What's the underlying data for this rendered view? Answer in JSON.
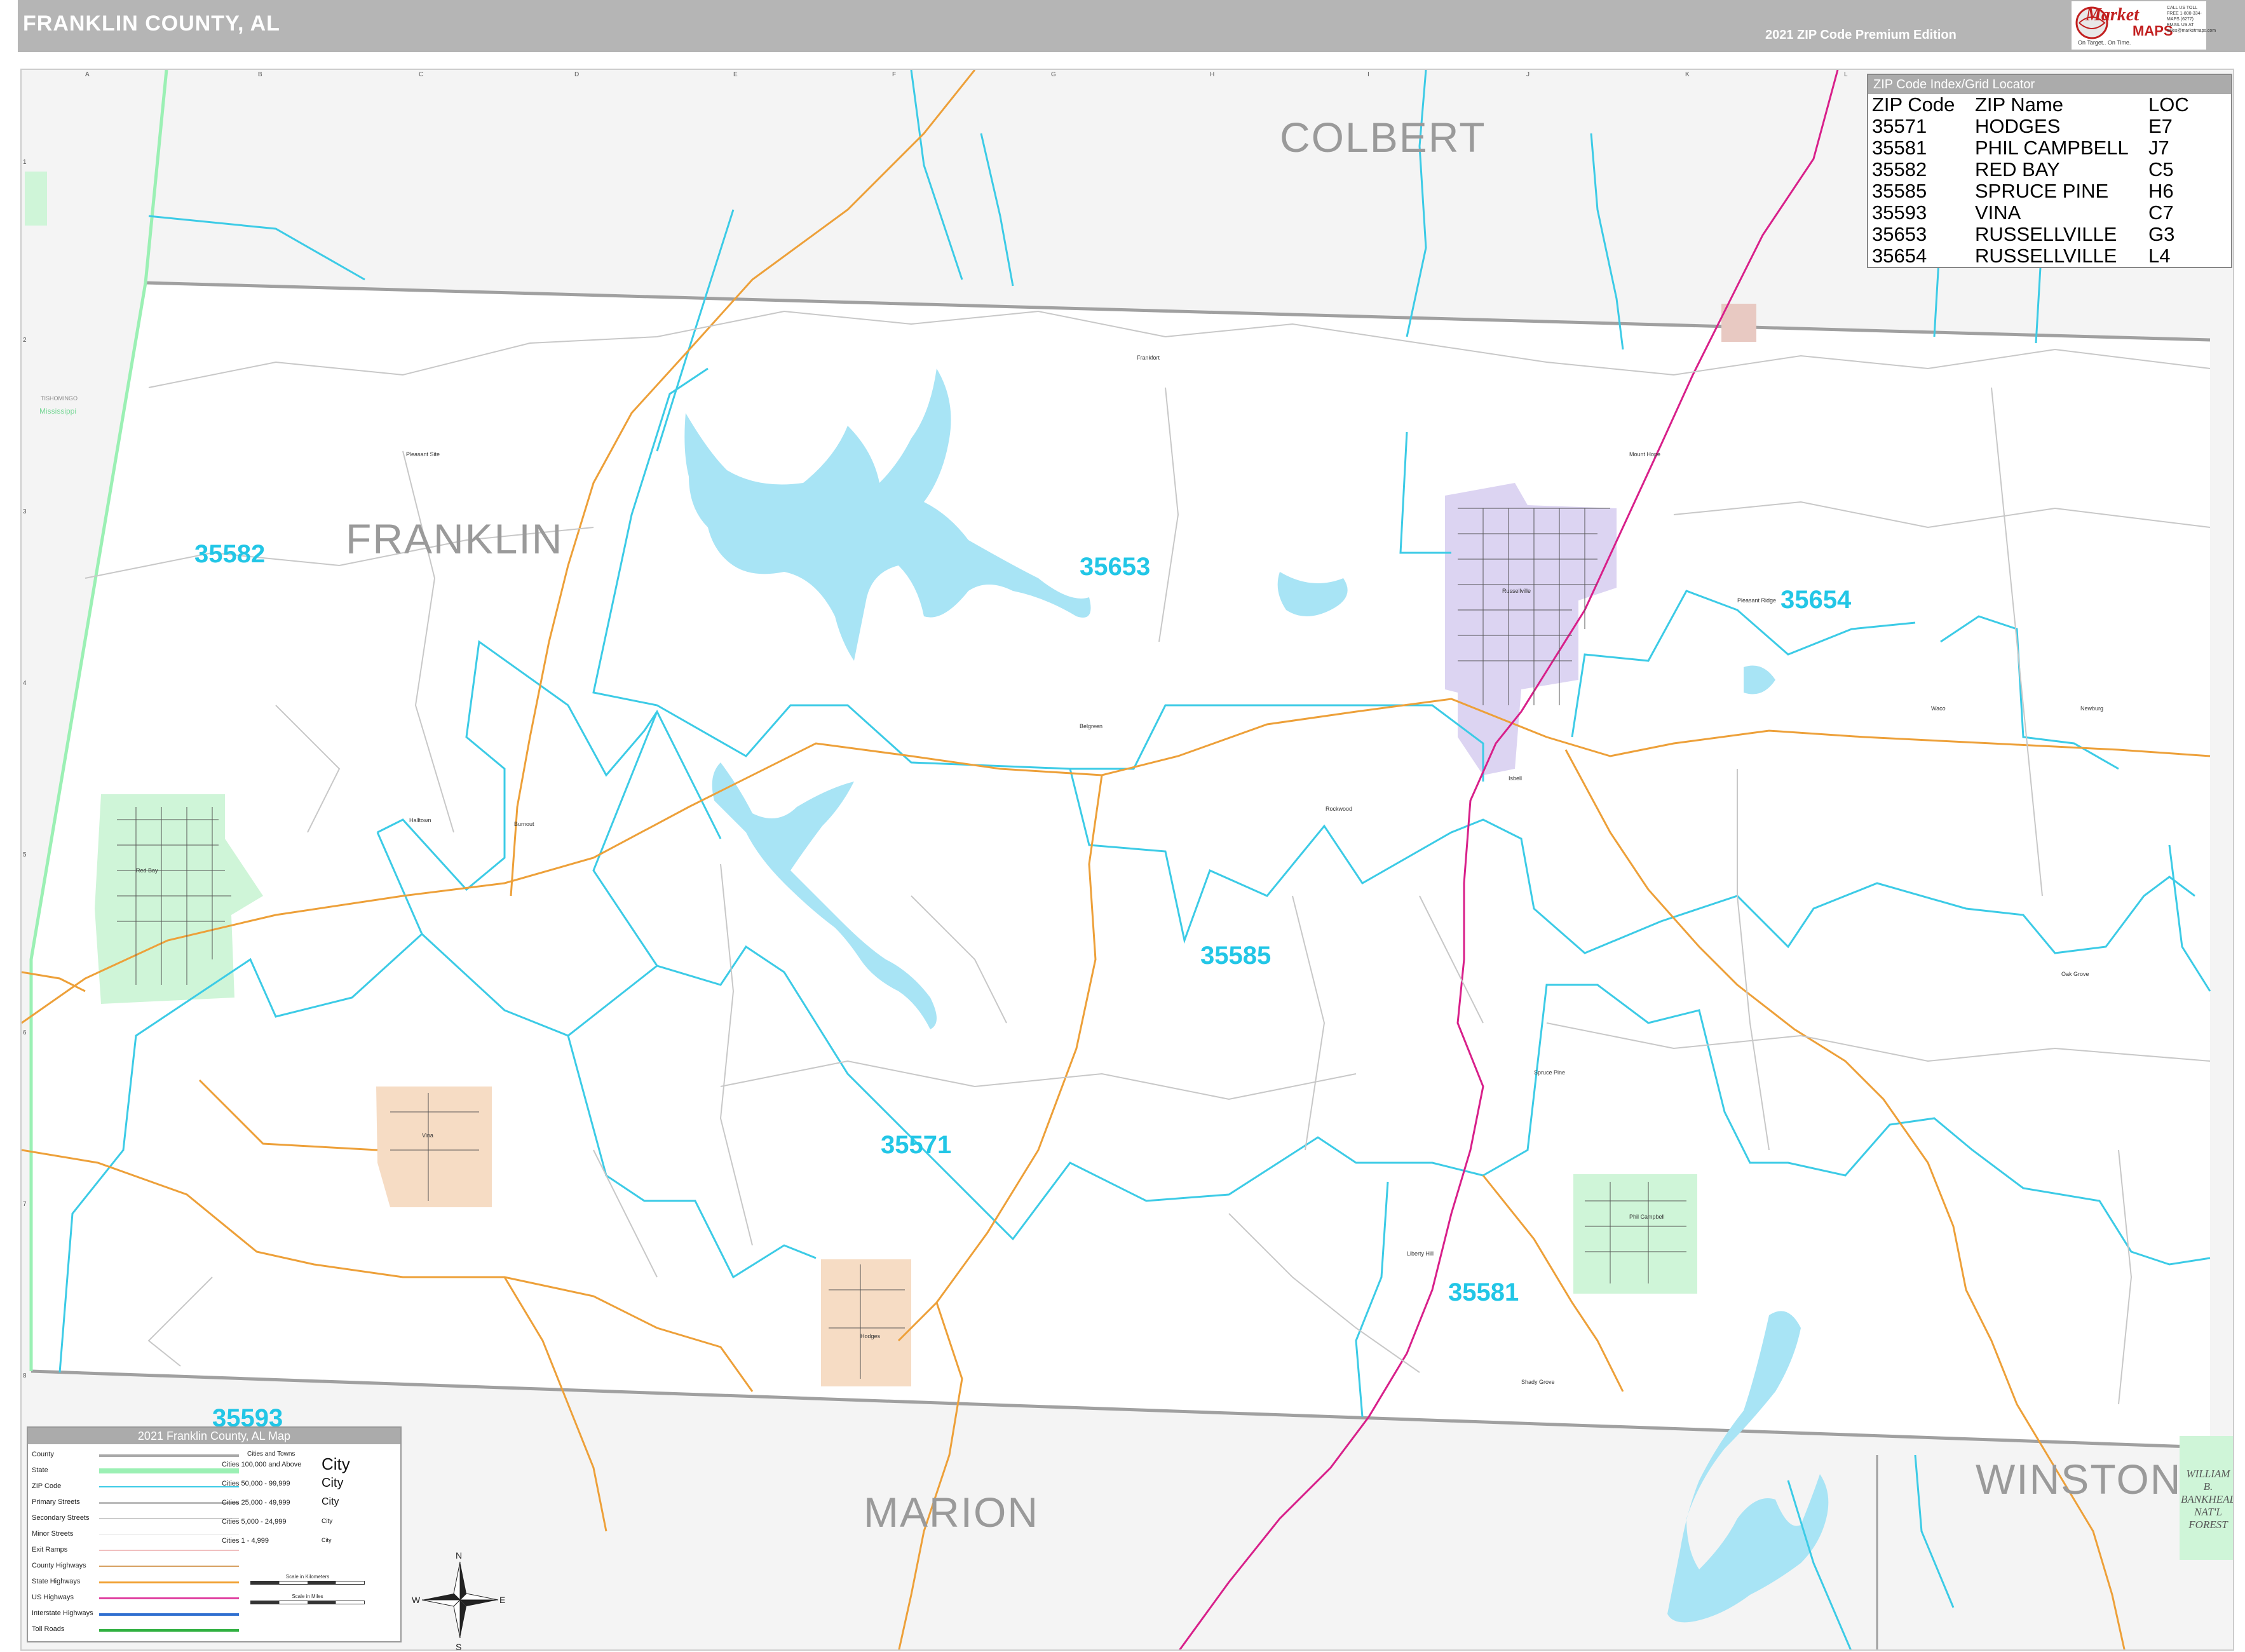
{
  "header": {
    "title": "FRANKLIN COUNTY, AL",
    "edition": "2021 ZIP Code Premium Edition"
  },
  "logo": {
    "brand_top": "Market",
    "brand_bottom": "MAPS",
    "tagline": "On Target.. On Time.",
    "subtag": "America's Leading Source of Business Maps",
    "contact": "CALL US TOLL FREE 1-800-334-MAPS (6277) EMAIL US AT sales@marketmaps.com"
  },
  "regions": {
    "colbert": "COLBERT",
    "franklin": "FRANKLIN",
    "marion": "MARION",
    "winston": "WINSTON",
    "tishomingo": "TISHOMINGO",
    "mississippi": "Mississippi",
    "forest_line1": "WILLIAM",
    "forest_line2": "B.",
    "forest_line3": "BANKHEAD",
    "forest_line4": "NAT'L",
    "forest_line5": "FOREST"
  },
  "zip_labels": [
    "35582",
    "35653",
    "35654",
    "35585",
    "35571",
    "35581",
    "35593"
  ],
  "grid": {
    "columns": [
      "A",
      "B",
      "C",
      "D",
      "E",
      "F",
      "G",
      "H",
      "I",
      "J",
      "K",
      "L"
    ],
    "rows": [
      "1",
      "2",
      "3",
      "4",
      "5",
      "6",
      "7",
      "8"
    ]
  },
  "places": [
    "Frankfort",
    "Pleasant Site",
    "Russellville",
    "Red Bay",
    "Belgreen",
    "Vina",
    "Hodges",
    "Phil Campbell",
    "Spruce Pine",
    "Liberty Hill",
    "Isbell",
    "Newburg",
    "Mount Hope",
    "Pleasant Ridge",
    "Shady Grove",
    "Burnout",
    "Halltown",
    "Rockwood",
    "Oak Grove",
    "Waco"
  ],
  "zip_index": {
    "title": "ZIP Code Index/Grid Locator",
    "headers": [
      "ZIP Code",
      "ZIP Name",
      "LOC"
    ],
    "rows": [
      [
        "35571",
        "HODGES",
        "E7"
      ],
      [
        "35581",
        "PHIL CAMPBELL",
        "J7"
      ],
      [
        "35582",
        "RED BAY",
        "C5"
      ],
      [
        "35585",
        "SPRUCE PINE",
        "H6"
      ],
      [
        "35593",
        "VINA",
        "C7"
      ],
      [
        "35653",
        "RUSSELLVILLE",
        "G3"
      ],
      [
        "35654",
        "RUSSELLVILLE",
        "L4"
      ]
    ]
  },
  "legend": {
    "title": "2021 Franklin County, AL Map",
    "items": [
      {
        "label": "County",
        "color": "#a8a8a8"
      },
      {
        "label": "State",
        "color": "#9bf0b4"
      },
      {
        "label": "ZIP Code",
        "color": "#3ccbe6"
      },
      {
        "label": "Primary Streets",
        "color": "#bbbbbb"
      },
      {
        "label": "Secondary Streets",
        "color": "#cccccc"
      },
      {
        "label": "Minor Streets",
        "color": "#dddddd"
      },
      {
        "label": "Exit Ramps",
        "color": "#f0c0c0"
      },
      {
        "label": "County Highways",
        "color": "#d6a062"
      },
      {
        "label": "State Highways",
        "color": "#f0a030"
      },
      {
        "label": "US Highways",
        "color": "#e040a0"
      },
      {
        "label": "Interstate Highways",
        "color": "#2f6fd0"
      },
      {
        "label": "Toll Roads",
        "color": "#30b040"
      }
    ],
    "cities_header": "Cities and Towns",
    "cities": [
      {
        "label": "Cities 100,000 and Above",
        "demo": "City"
      },
      {
        "label": "Cities 50,000 - 99,999",
        "demo": "City"
      },
      {
        "label": "Cities 25,000 - 49,999",
        "demo": "City"
      },
      {
        "label": "Cities 5,000 - 24,999",
        "demo": "City"
      },
      {
        "label": "Cities 1 - 4,999",
        "demo": "City"
      }
    ],
    "scale_km": "Scale in Kilometers",
    "scale_mi": "Scale in Miles"
  },
  "compass": {
    "n": "N",
    "s": "S",
    "e": "E",
    "w": "W"
  },
  "colors": {
    "zip_boundary": "#3ccbe6",
    "water": "#a8e4f5",
    "county_line": "#a0a0a0",
    "state_line": "#9bf0b4",
    "state_highway": "#eda039",
    "us_highway": "#d8208a",
    "city_purple": "#dcd4f2",
    "city_green": "#cff5d8",
    "city_peach": "#f6dcc4",
    "zip_text": "#22c6e6",
    "region_text": "#9a9a9a"
  }
}
